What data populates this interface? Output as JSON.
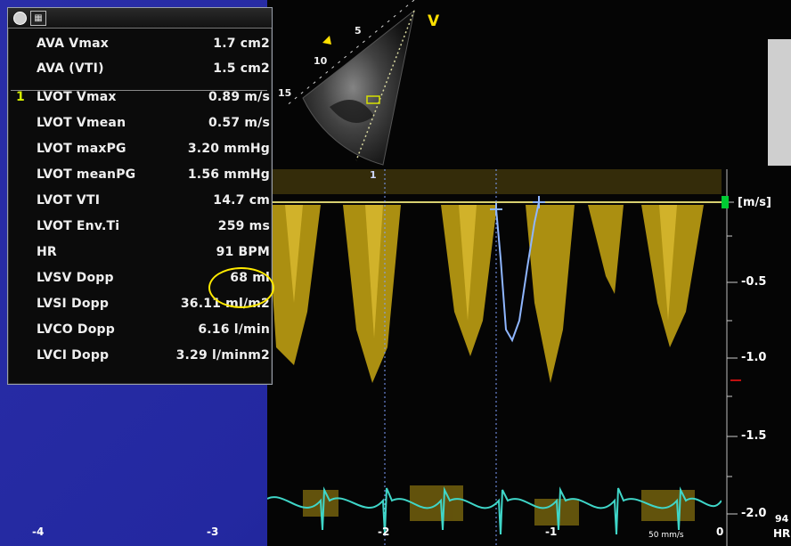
{
  "toolbar": {
    "grid_icon_glyph": "▦"
  },
  "sector": {
    "marker": "V",
    "depth_labels": [
      "5",
      "10",
      "15"
    ]
  },
  "measurements": [
    {
      "idx": "",
      "name": "AVA Vmax",
      "value": "1.7 cm2"
    },
    {
      "idx": "",
      "name": "AVA (VTI)",
      "value": "1.5 cm2"
    },
    {
      "idx": "1",
      "name": "LVOT Vmax",
      "value": "0.89 m/s"
    },
    {
      "idx": "",
      "name": "LVOT Vmean",
      "value": "0.57 m/s"
    },
    {
      "idx": "",
      "name": "LVOT maxPG",
      "value": "3.20 mmHg"
    },
    {
      "idx": "",
      "name": "LVOT meanPG",
      "value": "1.56 mmHg"
    },
    {
      "idx": "",
      "name": "LVOT VTI",
      "value": "14.7 cm"
    },
    {
      "idx": "",
      "name": "LVOT Env.Ti",
      "value": "259 ms"
    },
    {
      "idx": "",
      "name": "HR",
      "value": "91 BPM"
    },
    {
      "idx": "",
      "name": "LVSV Dopp",
      "value": "68 ml"
    },
    {
      "idx": "",
      "name": "LVSI Dopp",
      "value": "36.11 ml/m2"
    },
    {
      "idx": "",
      "name": "LVCO Dopp",
      "value": "6.16 l/min"
    },
    {
      "idx": "",
      "name": "LVCI Dopp",
      "value": "3.29 l/minm2"
    }
  ],
  "doppler": {
    "unit": "[m/s]",
    "scale_labels": [
      "-0.5",
      "-1.0",
      "-1.5",
      "-2.0"
    ],
    "time_labels": [
      "-4",
      "-3",
      "-2",
      "-1",
      "0"
    ],
    "cursor_index": "1",
    "sweep_speed": "50 mm/s",
    "hr_prefix": "HR",
    "hr_value_partial": "94"
  },
  "colors": {
    "background": "#2328a0",
    "doppler_signal": "#e8c21a",
    "ecg": "#3fd6c8",
    "envelope": "#8fb6ff",
    "highlight": "#ffea00",
    "scale_marker": "#00cc33"
  }
}
